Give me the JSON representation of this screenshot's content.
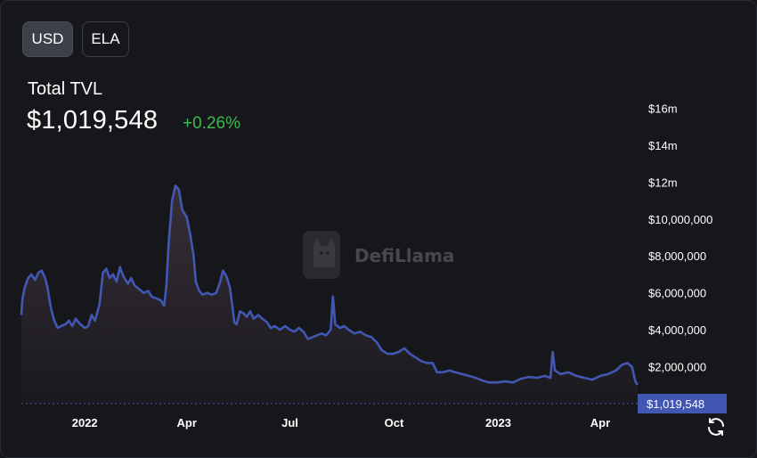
{
  "toggle": {
    "usd": "USD",
    "ela": "ELA",
    "active": "USD"
  },
  "header": {
    "title": "Total TVL",
    "value": "$1,019,548",
    "change": "+0.26%"
  },
  "watermark": {
    "text": "DefiLlama",
    "icon": "llama-logo-icon"
  },
  "refresh_icon": "refresh-icon",
  "colors": {
    "background": "#16171b",
    "line": "#4257b2",
    "change_positive": "#3fb950",
    "axis_text": "#ffffff"
  },
  "chart_data": {
    "type": "area",
    "title": "Total TVL",
    "ylabel": "",
    "xlabel": "",
    "ylim": [
      0,
      18000000
    ],
    "grid": false,
    "y_ticks": [
      {
        "value": 2000000,
        "label": "$2,000,000"
      },
      {
        "value": 4000000,
        "label": "$4,000,000"
      },
      {
        "value": 6000000,
        "label": "$6,000,000"
      },
      {
        "value": 8000000,
        "label": "$8,000,000"
      },
      {
        "value": 10000000,
        "label": "$10,000,000"
      },
      {
        "value": 12000000,
        "label": "$12m"
      },
      {
        "value": 14000000,
        "label": "$14m"
      },
      {
        "value": 16000000,
        "label": "$16m"
      }
    ],
    "x_ticks": [
      {
        "date": "2022-01-01",
        "label": "2022"
      },
      {
        "date": "2022-04-01",
        "label": "Apr"
      },
      {
        "date": "2022-07-01",
        "label": "Jul"
      },
      {
        "date": "2022-10-01",
        "label": "Oct"
      },
      {
        "date": "2023-01-01",
        "label": "2023"
      },
      {
        "date": "2023-04-01",
        "label": "Apr"
      }
    ],
    "current": {
      "value": 1019548,
      "label": "$1,019,548"
    },
    "series": [
      {
        "points": [
          [
            "2021-11-06",
            4800000
          ],
          [
            "2021-11-07",
            5700000
          ],
          [
            "2021-11-09",
            6300000
          ],
          [
            "2021-11-12",
            6800000
          ],
          [
            "2021-11-15",
            7000000
          ],
          [
            "2021-11-18",
            6700000
          ],
          [
            "2021-11-21",
            7100000
          ],
          [
            "2021-11-24",
            7200000
          ],
          [
            "2021-11-27",
            6800000
          ],
          [
            "2021-11-29",
            6300000
          ],
          [
            "2021-12-02",
            5200000
          ],
          [
            "2021-12-05",
            4500000
          ],
          [
            "2021-12-08",
            4100000
          ],
          [
            "2021-12-11",
            4200000
          ],
          [
            "2021-12-15",
            4300000
          ],
          [
            "2021-12-18",
            4500000
          ],
          [
            "2021-12-21",
            4200000
          ],
          [
            "2021-12-24",
            4600000
          ],
          [
            "2021-12-28",
            4300000
          ],
          [
            "2022-01-01",
            4100000
          ],
          [
            "2022-01-04",
            4200000
          ],
          [
            "2022-01-07",
            4800000
          ],
          [
            "2022-01-10",
            4500000
          ],
          [
            "2022-01-14",
            5400000
          ],
          [
            "2022-01-17",
            7100000
          ],
          [
            "2022-01-20",
            7300000
          ],
          [
            "2022-01-23",
            6800000
          ],
          [
            "2022-01-26",
            7000000
          ],
          [
            "2022-01-29",
            6600000
          ],
          [
            "2022-02-01",
            7400000
          ],
          [
            "2022-02-04",
            6900000
          ],
          [
            "2022-02-08",
            6500000
          ],
          [
            "2022-02-11",
            6800000
          ],
          [
            "2022-02-14",
            6400000
          ],
          [
            "2022-02-18",
            6200000
          ],
          [
            "2022-02-22",
            6000000
          ],
          [
            "2022-02-26",
            6100000
          ],
          [
            "2022-03-01",
            5800000
          ],
          [
            "2022-03-05",
            5700000
          ],
          [
            "2022-03-09",
            5600000
          ],
          [
            "2022-03-12",
            5300000
          ],
          [
            "2022-03-14",
            6400000
          ],
          [
            "2022-03-16",
            8700000
          ],
          [
            "2022-03-19",
            11000000
          ],
          [
            "2022-03-22",
            11800000
          ],
          [
            "2022-03-25",
            11600000
          ],
          [
            "2022-03-28",
            10500000
          ],
          [
            "2022-04-01",
            10100000
          ],
          [
            "2022-04-04",
            9200000
          ],
          [
            "2022-04-07",
            8000000
          ],
          [
            "2022-04-09",
            6600000
          ],
          [
            "2022-04-12",
            6100000
          ],
          [
            "2022-04-15",
            5900000
          ],
          [
            "2022-04-19",
            6000000
          ],
          [
            "2022-04-23",
            5900000
          ],
          [
            "2022-04-27",
            6000000
          ],
          [
            "2022-04-30",
            6500000
          ],
          [
            "2022-05-03",
            7200000
          ],
          [
            "2022-05-06",
            6900000
          ],
          [
            "2022-05-09",
            6300000
          ],
          [
            "2022-05-11",
            5400000
          ],
          [
            "2022-05-13",
            4400000
          ],
          [
            "2022-05-15",
            4300000
          ],
          [
            "2022-05-18",
            5000000
          ],
          [
            "2022-05-21",
            4900000
          ],
          [
            "2022-05-24",
            4700000
          ],
          [
            "2022-05-27",
            5000000
          ],
          [
            "2022-05-30",
            4600000
          ],
          [
            "2022-06-03",
            4800000
          ],
          [
            "2022-06-07",
            4600000
          ],
          [
            "2022-06-11",
            4400000
          ],
          [
            "2022-06-14",
            4100000
          ],
          [
            "2022-06-18",
            4200000
          ],
          [
            "2022-06-22",
            4000000
          ],
          [
            "2022-06-27",
            4200000
          ],
          [
            "2022-07-01",
            4000000
          ],
          [
            "2022-07-05",
            3900000
          ],
          [
            "2022-07-09",
            4100000
          ],
          [
            "2022-07-13",
            3900000
          ],
          [
            "2022-07-17",
            3500000
          ],
          [
            "2022-07-21",
            3600000
          ],
          [
            "2022-07-25",
            3700000
          ],
          [
            "2022-07-29",
            3800000
          ],
          [
            "2022-08-02",
            3700000
          ],
          [
            "2022-08-06",
            4000000
          ],
          [
            "2022-08-08",
            5800000
          ],
          [
            "2022-08-10",
            4300000
          ],
          [
            "2022-08-14",
            4100000
          ],
          [
            "2022-08-18",
            4200000
          ],
          [
            "2022-08-22",
            4000000
          ],
          [
            "2022-08-27",
            3800000
          ],
          [
            "2022-09-01",
            3900000
          ],
          [
            "2022-09-06",
            3700000
          ],
          [
            "2022-09-11",
            3600000
          ],
          [
            "2022-09-16",
            3300000
          ],
          [
            "2022-09-20",
            2900000
          ],
          [
            "2022-09-25",
            2700000
          ],
          [
            "2022-09-30",
            2700000
          ],
          [
            "2022-10-05",
            2800000
          ],
          [
            "2022-10-10",
            3000000
          ],
          [
            "2022-10-15",
            2700000
          ],
          [
            "2022-10-20",
            2500000
          ],
          [
            "2022-10-25",
            2300000
          ],
          [
            "2022-10-30",
            2200000
          ],
          [
            "2022-11-04",
            2200000
          ],
          [
            "2022-11-08",
            1700000
          ],
          [
            "2022-11-13",
            1700000
          ],
          [
            "2022-11-19",
            1800000
          ],
          [
            "2022-11-24",
            1700000
          ],
          [
            "2022-11-30",
            1600000
          ],
          [
            "2022-12-06",
            1500000
          ],
          [
            "2022-12-12",
            1400000
          ],
          [
            "2022-12-18",
            1250000
          ],
          [
            "2022-12-24",
            1150000
          ],
          [
            "2022-12-31",
            1150000
          ],
          [
            "2023-01-07",
            1200000
          ],
          [
            "2023-01-14",
            1150000
          ],
          [
            "2023-01-21",
            1350000
          ],
          [
            "2023-01-28",
            1450000
          ],
          [
            "2023-02-04",
            1400000
          ],
          [
            "2023-02-11",
            1500000
          ],
          [
            "2023-02-16",
            1400000
          ],
          [
            "2023-02-18",
            2800000
          ],
          [
            "2023-02-20",
            1800000
          ],
          [
            "2023-02-25",
            1600000
          ],
          [
            "2023-03-04",
            1700000
          ],
          [
            "2023-03-11",
            1500000
          ],
          [
            "2023-03-18",
            1400000
          ],
          [
            "2023-03-25",
            1300000
          ],
          [
            "2023-04-01",
            1500000
          ],
          [
            "2023-04-08",
            1600000
          ],
          [
            "2023-04-15",
            1800000
          ],
          [
            "2023-04-20",
            2100000
          ],
          [
            "2023-04-25",
            2200000
          ],
          [
            "2023-04-29",
            2000000
          ],
          [
            "2023-05-02",
            1200000
          ],
          [
            "2023-05-04",
            1019548
          ]
        ]
      }
    ]
  }
}
